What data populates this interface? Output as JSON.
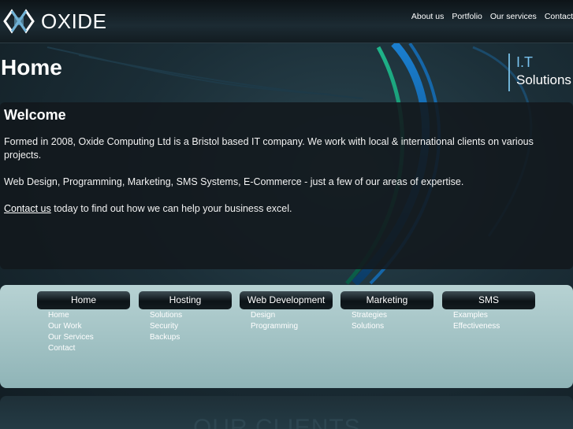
{
  "header": {
    "logo_text": "OXIDE",
    "nav": [
      "About us",
      "Portfolio",
      "Our services",
      "Contact"
    ]
  },
  "page": {
    "title": "Home",
    "tagline_line1": "I.T",
    "tagline_line2": "Solutions"
  },
  "welcome": {
    "heading": "Welcome",
    "para1": "Formed in 2008, Oxide Computing Ltd is a Bristol based IT company. We work with local & international clients on various projects.",
    "para2": "Web Design, Programming, Marketing, SMS Systems, E-Commerce - just a few of our areas of expertise.",
    "contact_link": "Contact us",
    "para3_rest": " today to find out how we can help your business excel."
  },
  "menu": [
    {
      "title": "Home",
      "links": [
        "Home",
        "Our Work",
        "Our Services",
        "Contact"
      ]
    },
    {
      "title": "Hosting",
      "links": [
        "Solutions",
        "Security",
        "Backups"
      ]
    },
    {
      "title": "Web Development",
      "links": [
        "Design",
        "Programming"
      ]
    },
    {
      "title": "Marketing",
      "links": [
        "Strategies",
        "Solutions"
      ]
    },
    {
      "title": "SMS",
      "links": [
        "Examples",
        "Effectiveness"
      ]
    }
  ],
  "clients": {
    "title": "OUR CLIENTS"
  }
}
